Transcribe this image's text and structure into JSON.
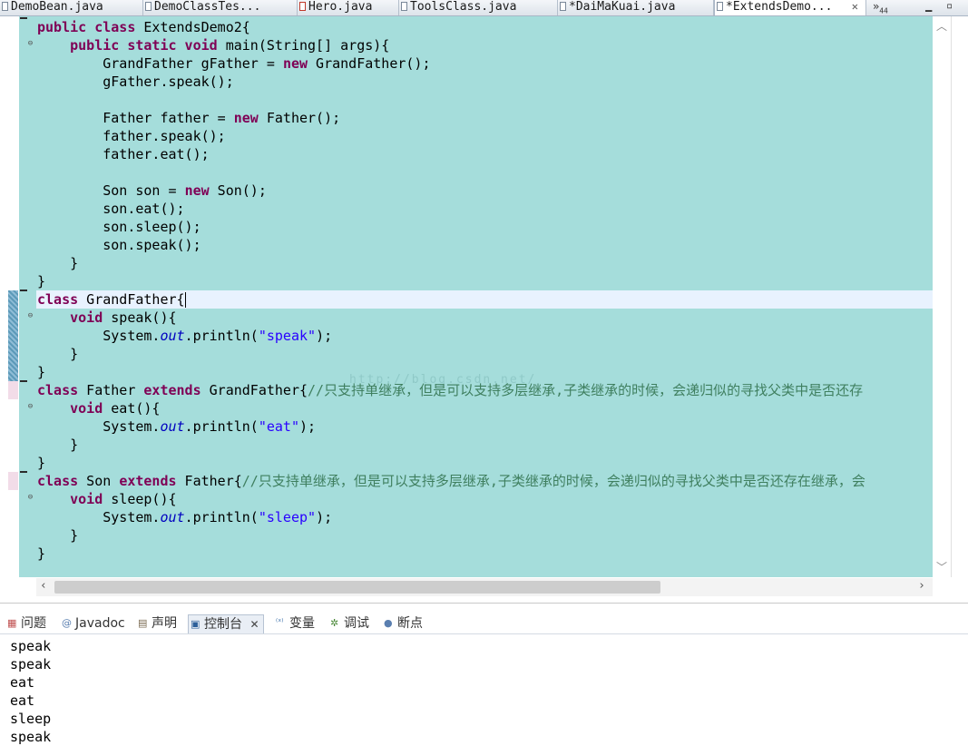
{
  "editor_tabs": [
    {
      "label": "DemoBean.java",
      "icon": "java-file-icon"
    },
    {
      "label": "DemoClassTes...",
      "icon": "java-file-icon"
    },
    {
      "label": "Hero.java",
      "icon": "java-error-file-icon"
    },
    {
      "label": "ToolsClass.java",
      "icon": "java-file-icon"
    },
    {
      "label": "*DaiMaKuai.java",
      "icon": "java-warning-file-icon"
    },
    {
      "label": "*ExtendsDemo...",
      "icon": "java-file-icon",
      "active": true,
      "close": "✕"
    }
  ],
  "tabs_overflow": {
    "symbol": "»",
    "count": "44"
  },
  "code_lines": [
    [
      {
        "t": "public class",
        "c": "kw"
      },
      {
        "t": " ExtendsDemo2{"
      }
    ],
    [
      {
        "t": "    "
      },
      {
        "t": "public static void",
        "c": "kw"
      },
      {
        "t": " main(String[] args){"
      }
    ],
    [
      {
        "t": "        GrandFather gFather = "
      },
      {
        "t": "new",
        "c": "kw"
      },
      {
        "t": " GrandFather();"
      }
    ],
    [
      {
        "t": "        gFather.speak();"
      }
    ],
    [
      {
        "t": ""
      }
    ],
    [
      {
        "t": "        Father father = "
      },
      {
        "t": "new",
        "c": "kw"
      },
      {
        "t": " Father();"
      }
    ],
    [
      {
        "t": "        father.speak();"
      }
    ],
    [
      {
        "t": "        father.eat();"
      }
    ],
    [
      {
        "t": ""
      }
    ],
    [
      {
        "t": "        Son son = "
      },
      {
        "t": "new",
        "c": "kw"
      },
      {
        "t": " Son();"
      }
    ],
    [
      {
        "t": "        son.eat();"
      }
    ],
    [
      {
        "t": "        son.sleep();"
      }
    ],
    [
      {
        "t": "        son.speak();"
      }
    ],
    [
      {
        "t": "    }"
      }
    ],
    [
      {
        "t": "}"
      }
    ],
    [
      {
        "t": "class",
        "c": "kw"
      },
      {
        "t": " GrandFather{"
      },
      {
        "t": "",
        "c": "caret"
      }
    ],
    [
      {
        "t": "    "
      },
      {
        "t": "void",
        "c": "kw"
      },
      {
        "t": " speak(){"
      }
    ],
    [
      {
        "t": "        System."
      },
      {
        "t": "out",
        "c": "fld"
      },
      {
        "t": ".println("
      },
      {
        "t": "\"speak\"",
        "c": "str"
      },
      {
        "t": ");"
      }
    ],
    [
      {
        "t": "    }"
      }
    ],
    [
      {
        "t": "}"
      }
    ],
    [
      {
        "t": "class",
        "c": "kw"
      },
      {
        "t": " Father "
      },
      {
        "t": "extends",
        "c": "kw"
      },
      {
        "t": " GrandFather{"
      },
      {
        "t": "//只支持单继承，但是可以支持多层继承,子类继承的时候，会递归似的寻找父类中是否还存",
        "c": "cmt"
      }
    ],
    [
      {
        "t": "    "
      },
      {
        "t": "void",
        "c": "kw"
      },
      {
        "t": " eat(){"
      }
    ],
    [
      {
        "t": "        System."
      },
      {
        "t": "out",
        "c": "fld"
      },
      {
        "t": ".println("
      },
      {
        "t": "\"eat\"",
        "c": "str"
      },
      {
        "t": ");"
      }
    ],
    [
      {
        "t": "    }"
      }
    ],
    [
      {
        "t": "}"
      }
    ],
    [
      {
        "t": "class",
        "c": "kw"
      },
      {
        "t": " Son "
      },
      {
        "t": "extends",
        "c": "kw"
      },
      {
        "t": " Father{"
      },
      {
        "t": "//只支持单继承，但是可以支持多层继承,子类继承的时候，会递归似的寻找父类中是否还存在继承，会",
        "c": "cmt"
      }
    ],
    [
      {
        "t": "    "
      },
      {
        "t": "void",
        "c": "kw"
      },
      {
        "t": " sleep(){"
      }
    ],
    [
      {
        "t": "        System."
      },
      {
        "t": "out",
        "c": "fld"
      },
      {
        "t": ".println("
      },
      {
        "t": "\"sleep\"",
        "c": "str"
      },
      {
        "t": ");"
      }
    ],
    [
      {
        "t": "    }"
      }
    ],
    [
      {
        "t": "}"
      }
    ]
  ],
  "watermark": "http://blog.csdn.net/",
  "view_tabs": [
    {
      "label": "问题",
      "icon": "problems-icon",
      "glyph": "▦"
    },
    {
      "label": "Javadoc",
      "icon": "javadoc-icon",
      "glyph": "@"
    },
    {
      "label": "声明",
      "icon": "declaration-icon",
      "glyph": "▤"
    },
    {
      "label": "控制台",
      "icon": "console-icon",
      "glyph": "▣",
      "active": true,
      "close": "✕"
    },
    {
      "label": "变量",
      "icon": "variables-icon",
      "glyph": "⁽ˣ⁾"
    },
    {
      "label": "调试",
      "icon": "debug-icon",
      "glyph": "✲"
    },
    {
      "label": "断点",
      "icon": "breakpoints-icon",
      "glyph": "●"
    }
  ],
  "console_output": [
    "speak",
    "speak",
    "eat",
    "eat",
    "sleep",
    "speak"
  ],
  "colors": {
    "editor_bg": "#a5dddb",
    "current_line": "#e8f2fe",
    "keyword": "#7f0055",
    "string": "#2a00ff",
    "field": "#0000c0",
    "comment": "#3f7f5f"
  }
}
